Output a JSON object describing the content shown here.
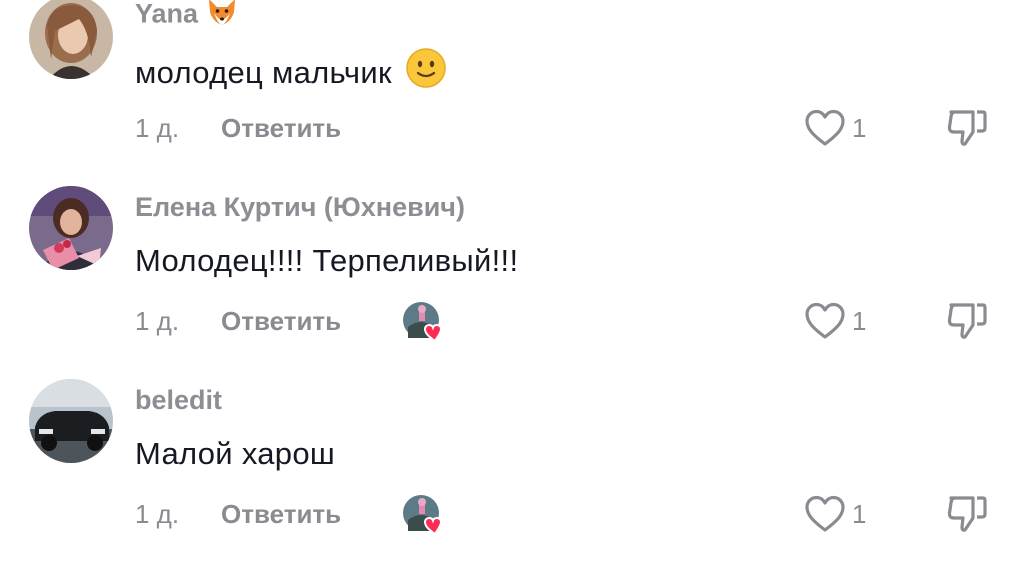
{
  "comments": [
    {
      "username": "Yana",
      "username_emoji": "fox-emoji",
      "text": "молодец мальчик",
      "text_emoji": "slightly-smiling-face-emoji",
      "time": "1 д.",
      "reply_label": "Ответить",
      "creator_liked": false,
      "like_count": "1"
    },
    {
      "username": "Елена Куртич (Юхневич)",
      "text": "Молодец!!!! Терпеливый!!!",
      "time": "1 д.",
      "reply_label": "Ответить",
      "creator_liked": true,
      "like_count": "1"
    },
    {
      "username": "beledit",
      "text": "Малой харош",
      "time": "1 д.",
      "reply_label": "Ответить",
      "creator_liked": true,
      "like_count": "1"
    }
  ],
  "colors": {
    "username": "#8d8d93",
    "text": "#161823",
    "meta": "#8a8b91",
    "heart_accent": "#fe2c55"
  },
  "icons": {
    "like": "heart-outline-icon",
    "dislike": "thumbs-down-icon",
    "creator_like": "creator-liked-heart-icon"
  }
}
